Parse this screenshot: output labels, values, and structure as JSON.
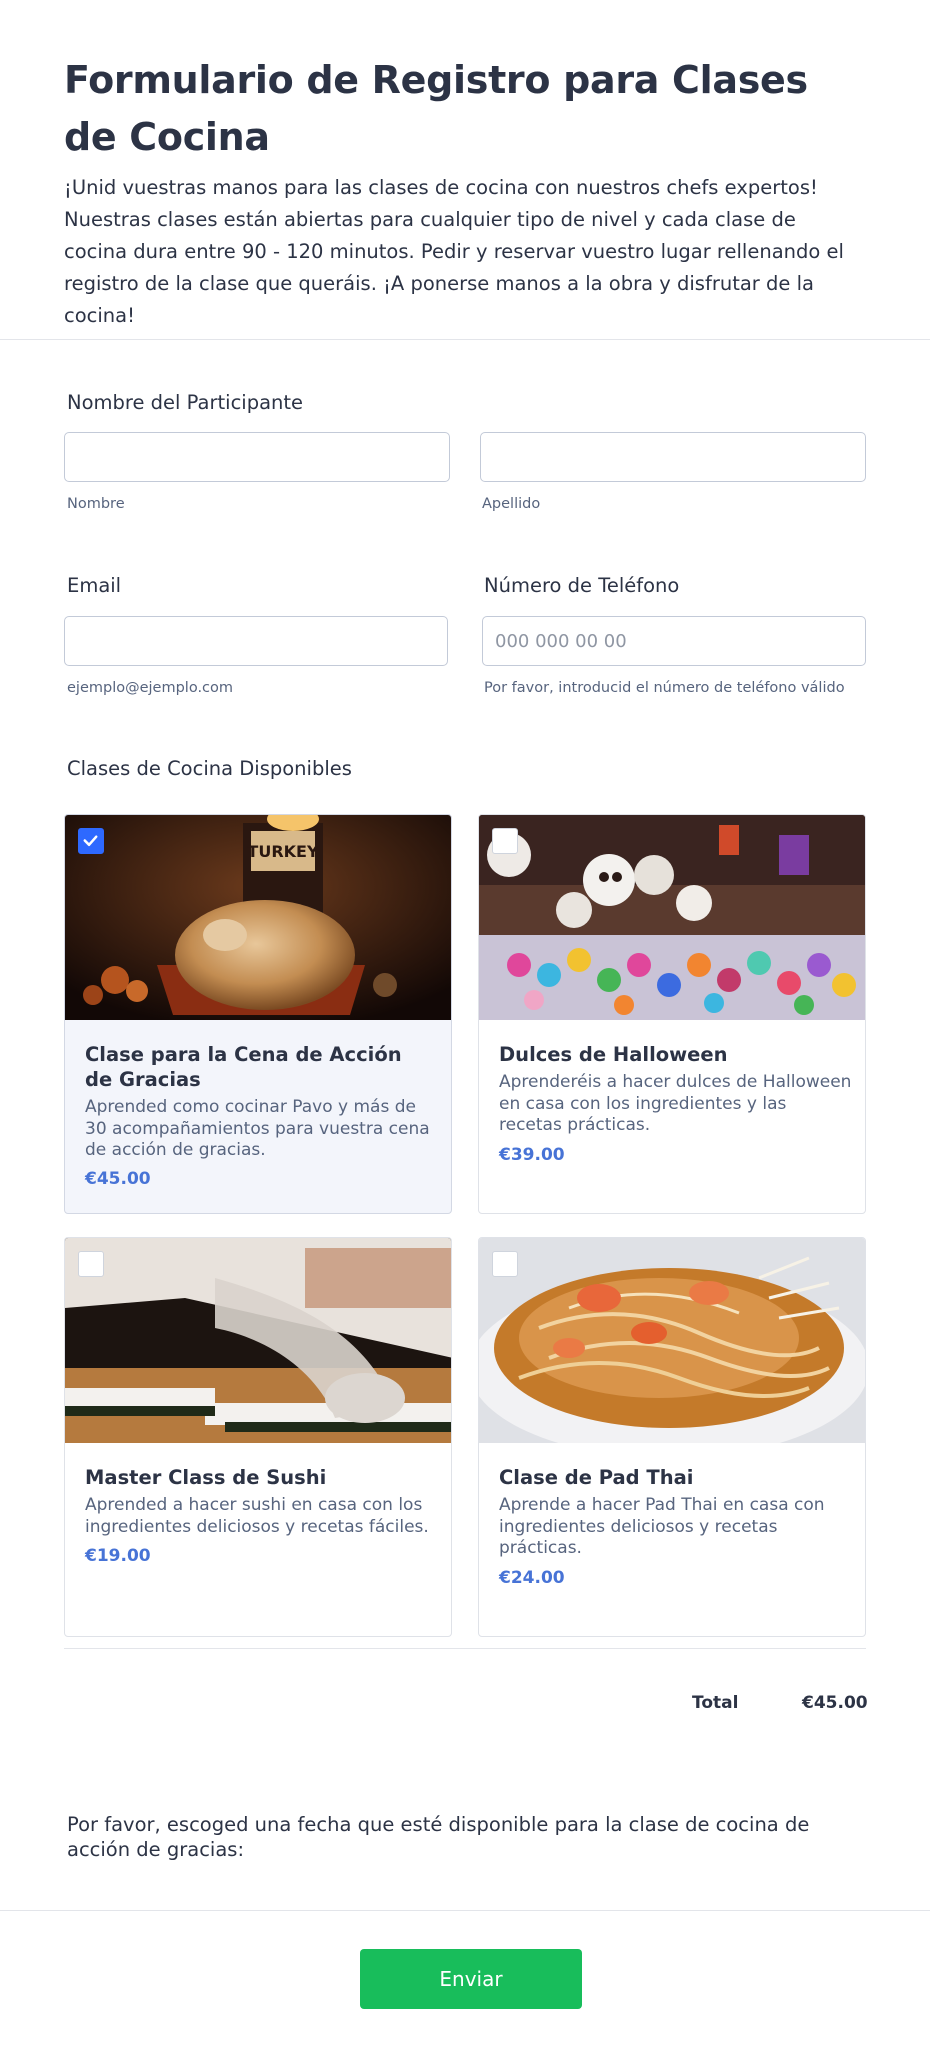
{
  "header": {
    "title": "Formulario de Registro para Clases de Cocina",
    "description": "¡Unid vuestras manos para las clases de cocina con nuestros chefs expertos! Nuestras clases están abiertas para cualquier tipo de nivel y cada clase de cocina dura entre 90 - 120 minutos. Pedir y reservar vuestro lugar rellenando el registro de la clase que queráis. ¡A ponerse manos a la obra y disfrutar de la cocina!"
  },
  "participant": {
    "label": "Nombre del Participante",
    "first": {
      "value": "",
      "sublabel": "Nombre"
    },
    "last": {
      "value": "",
      "sublabel": "Apellido"
    }
  },
  "email": {
    "label": "Email",
    "value": "",
    "sublabel": "ejemplo@ejemplo.com"
  },
  "phone": {
    "label": "Número de Teléfono",
    "value": "",
    "placeholder": "000 000 00 00",
    "sublabel": "Por favor, introducid el número de teléfono válido"
  },
  "classes": {
    "label": "Clases de Cocina Disponibles",
    "items": [
      {
        "title": "Clase para la Cena de Acción de Gracias",
        "description": "Aprended como cocinar Pavo y más de 30 acompañamientos para vuestra cena de acción de gracias.",
        "price": "€45.00",
        "selected": true,
        "image": "roast-turkey-photo"
      },
      {
        "title": "Dulces de Halloween",
        "description": "Aprenderéis a hacer dulces de Halloween en casa con los ingredientes y las recetas prácticas.",
        "price": "€39.00",
        "selected": false,
        "image": "sugar-skulls-photo"
      },
      {
        "title": "Master Class de Sushi",
        "description": "Aprended a hacer sushi en casa con los ingredientes deliciosos y recetas fáciles.",
        "price": "€19.00",
        "selected": false,
        "image": "sushi-rolling-photo"
      },
      {
        "title": "Clase de Pad Thai",
        "description": "Aprende a hacer Pad Thai en casa con ingredientes deliciosos y recetas prácticas.",
        "price": "€24.00",
        "selected": false,
        "image": "pad-thai-photo"
      }
    ]
  },
  "total": {
    "label": "Total",
    "value": "€45.00"
  },
  "date_question": "Por favor, escoged una fecha que esté disponible para la clase de cocina de acción de gracias:",
  "submit": {
    "label": "Enviar"
  },
  "colors": {
    "accent": "#2e69ff",
    "price": "#4773d6",
    "submit": "#18bd5b",
    "text": "#2c3345"
  }
}
